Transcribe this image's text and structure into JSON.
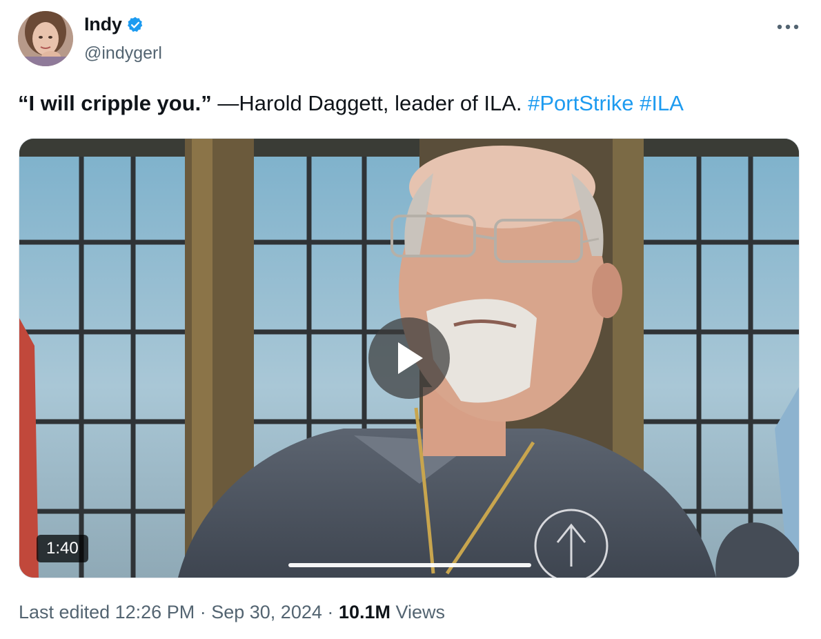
{
  "author": {
    "display_name": "Indy",
    "handle": "@indygerl",
    "verified": true
  },
  "icons": {
    "verified": "verified-badge-icon",
    "more": "more-options-icon",
    "play": "play-icon"
  },
  "colors": {
    "text": "#0f1419",
    "secondary": "#536471",
    "link": "#1d9bf0",
    "verified": "#1d9bf0"
  },
  "tweet": {
    "quote": "“I will cripple you.”",
    "attribution": " —Harold Daggett, leader of ILA. ",
    "hashtag_1": "#PortStrike",
    "hashtag_2": "#ILA"
  },
  "video": {
    "duration": "1:40",
    "progress": 0
  },
  "meta": {
    "edited_label": "Last edited",
    "time": "12:26 PM",
    "separator": "·",
    "date": "Sep 30, 2024",
    "views_count": "10.1M",
    "views_label": "Views"
  }
}
